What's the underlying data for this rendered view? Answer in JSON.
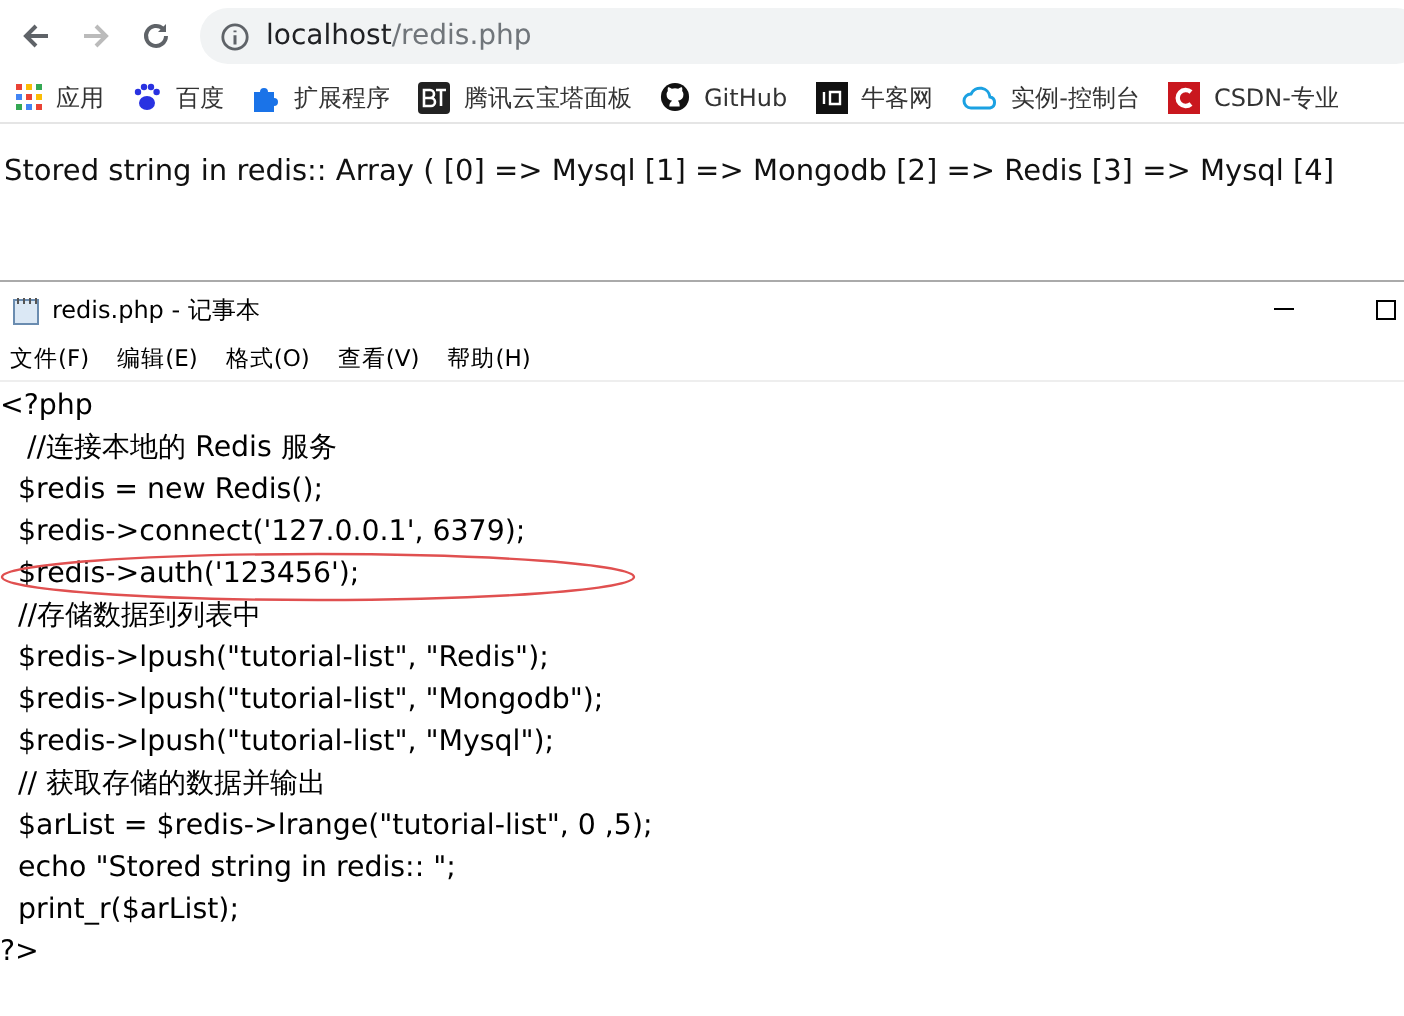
{
  "browser": {
    "url": {
      "host": "localhost",
      "path": "/redis.php"
    },
    "bookmarks": [
      {
        "label": "应用",
        "kind": "apps"
      },
      {
        "label": "百度",
        "kind": "paw"
      },
      {
        "label": "扩展程序",
        "kind": "puzzle"
      },
      {
        "label": "腾讯云宝塔面板",
        "kind": "bt"
      },
      {
        "label": "GitHub",
        "kind": "cat"
      },
      {
        "label": "牛客网",
        "kind": "dark"
      },
      {
        "label": "实例-控制台",
        "kind": "cloud"
      },
      {
        "label": "CSDN-专业",
        "kind": "c"
      }
    ]
  },
  "page": {
    "output": "Stored string in redis:: Array ( [0] => Mysql [1] => Mongodb [2] => Redis [3] => Mysql [4]"
  },
  "notepad": {
    "title": "redis.php - 记事本",
    "menu": [
      "文件(F)",
      "编辑(E)",
      "格式(O)",
      "查看(V)",
      "帮助(H)"
    ],
    "lines": [
      "<?php",
      "   //连接本地的 Redis 服务",
      "  $redis = new Redis();",
      "  $redis->connect('127.0.0.1', 6379);",
      "  $redis->auth('123456');",
      "  //存储数据到列表中",
      "  $redis->lpush(\"tutorial-list\", \"Redis\");",
      "  $redis->lpush(\"tutorial-list\", \"Mongodb\");",
      "  $redis->lpush(\"tutorial-list\", \"Mysql\");",
      "  // 获取存储的数据并输出",
      "  $arList = $redis->lrange(\"tutorial-list\", 0 ,5);",
      "  echo \"Stored string in redis:: \";",
      "  print_r($arList);",
      "?>"
    ]
  }
}
